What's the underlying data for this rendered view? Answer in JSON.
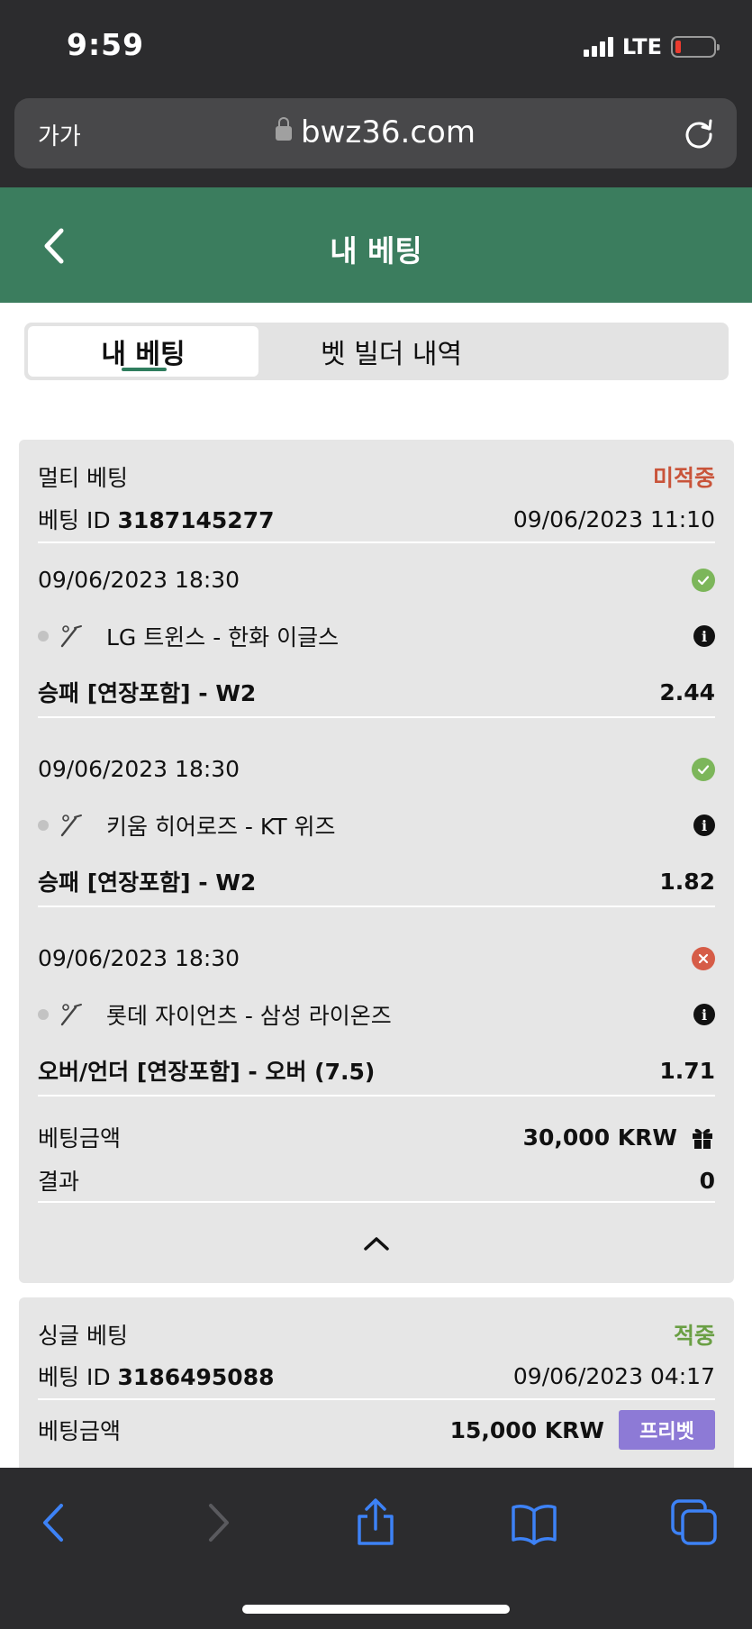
{
  "status_bar": {
    "time": "9:59",
    "network": "LTE"
  },
  "browser": {
    "text_size_label": "가가",
    "url": "bwz36.com"
  },
  "header": {
    "title": "내 베팅"
  },
  "tabs": [
    {
      "label": "내 베팅",
      "active": true
    },
    {
      "label": "벳 빌더 내역",
      "active": false
    }
  ],
  "colors": {
    "header_green": "#3b7d5e",
    "pending_red": "#c9543a",
    "win_green": "#6a9f44",
    "freebet_purple": "#8d7ad6"
  },
  "bets": [
    {
      "type": "멀티 베팅",
      "status": "미적중",
      "id_label": "베팅 ID",
      "id": "3187145277",
      "placed_at": "09/06/2023 11:10",
      "selections": [
        {
          "datetime": "09/06/2023 18:30",
          "result": "won",
          "match": "LG 트윈스 - 한화 이글스",
          "market": "승패 [연장포함] - W2",
          "odds": "2.44"
        },
        {
          "datetime": "09/06/2023 18:30",
          "result": "won",
          "match": "키움 히어로즈 - KT 위즈",
          "market": "승패 [연장포함] - W2",
          "odds": "1.82"
        },
        {
          "datetime": "09/06/2023 18:30",
          "result": "lost",
          "match": "롯데 자이언츠 - 삼성 라이온즈",
          "market": "오버/언더 [연장포함] - 오버 (7.5)",
          "odds": "1.71"
        }
      ],
      "stake_label": "베팅금액",
      "stake": "30,000 KRW",
      "result_label": "결과",
      "result_value": "0"
    },
    {
      "type": "싱글 베팅",
      "status": "적중",
      "id_label": "베팅 ID",
      "id": "3186495088",
      "placed_at": "09/06/2023 04:17",
      "stake_label": "베팅금액",
      "stake": "15,000 KRW",
      "badge": "프리벳"
    }
  ],
  "icons": [
    "lock-icon",
    "reload-icon",
    "back-chevron-icon",
    "check-icon",
    "x-icon",
    "info-icon",
    "baseball-icon",
    "gift-icon",
    "chevron-up-icon",
    "share-icon",
    "bookmarks-icon",
    "tabs-icon"
  ]
}
